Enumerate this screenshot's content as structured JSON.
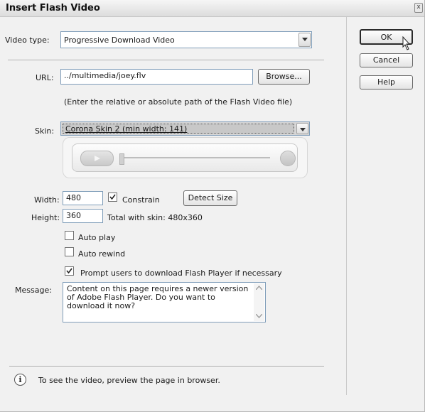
{
  "window": {
    "title": "Insert Flash Video",
    "close_glyph": "x"
  },
  "video_type": {
    "label": "Video type:",
    "value": "Progressive Download Video"
  },
  "url": {
    "label": "URL:",
    "value": "../multimedia/joey.flv",
    "browse_label": "Browse...",
    "hint": "(Enter the relative or absolute path of the Flash Video file)"
  },
  "skin": {
    "label": "Skin:",
    "value": "Corona Skin 2 (min width: 141)"
  },
  "width": {
    "label": "Width:",
    "value": "480",
    "constrain_label": "Constrain",
    "constrain_checked": true,
    "detect_label": "Detect Size"
  },
  "height": {
    "label": "Height:",
    "value": "360",
    "total_text": "Total with skin: 480x360"
  },
  "options": {
    "auto_play": {
      "label": "Auto play",
      "checked": false
    },
    "auto_rewind": {
      "label": "Auto rewind",
      "checked": false
    },
    "prompt": {
      "label": "Prompt users to download Flash Player if necessary",
      "checked": true
    }
  },
  "message": {
    "label": "Message:",
    "value": "Content on this page requires a newer version of Adobe Flash Player. Do you want to download it now?"
  },
  "footer": {
    "info_glyph": "i",
    "info_text": "To see the video, preview the page in browser."
  },
  "buttons": {
    "ok": "OK",
    "cancel": "Cancel",
    "help": "Help"
  }
}
